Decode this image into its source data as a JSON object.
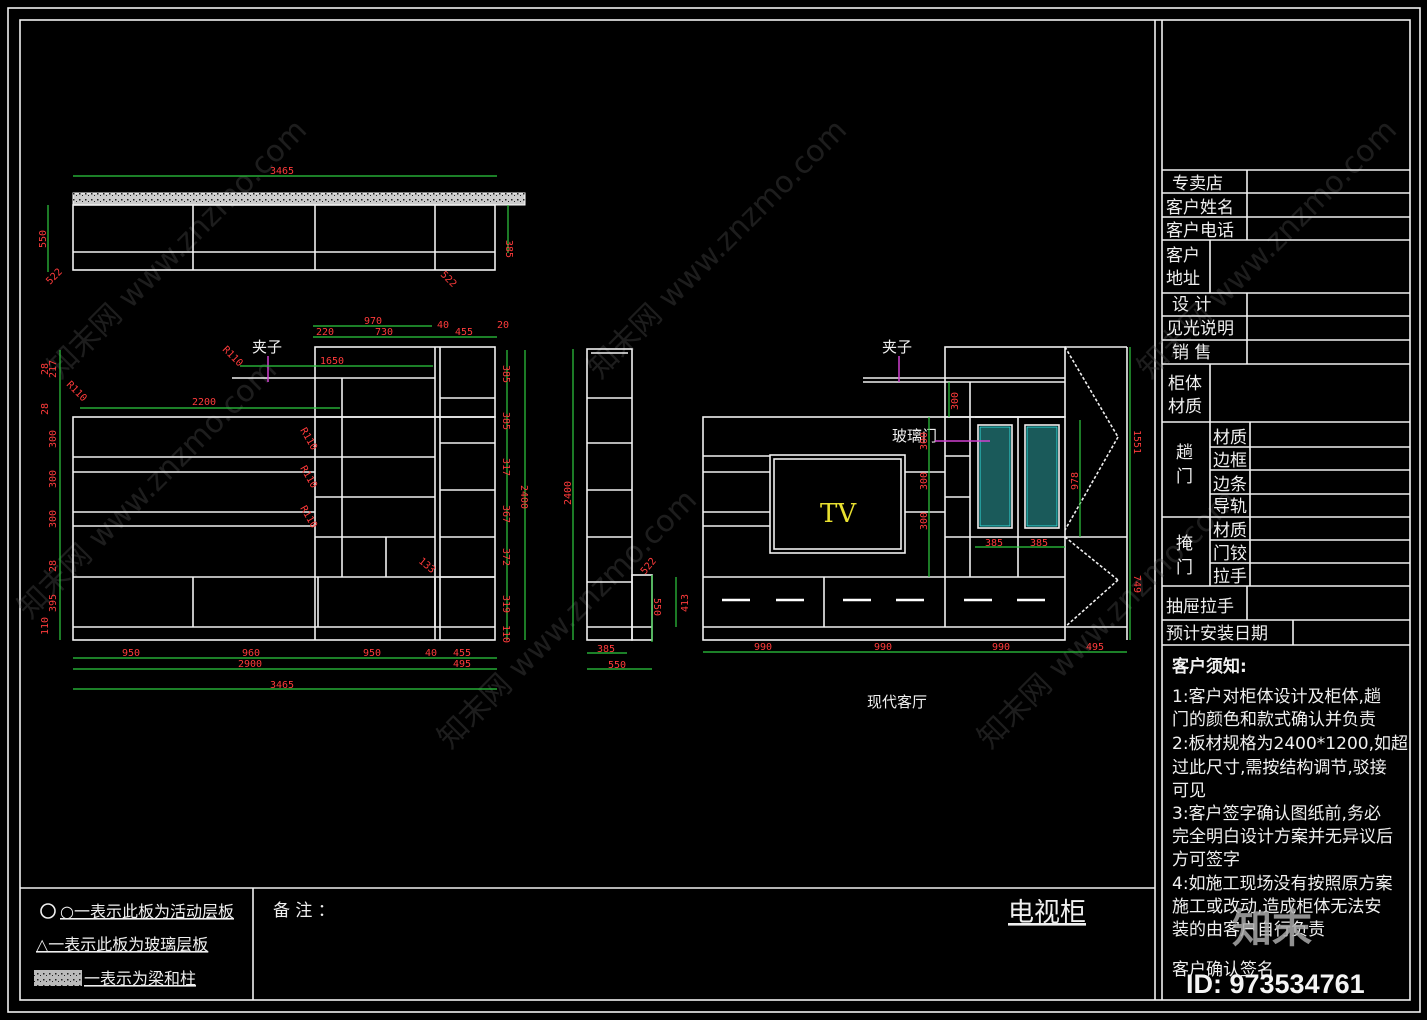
{
  "colors": {
    "background": "#000000",
    "lines": "#f0f0f0",
    "dimension_lines": "#2ecc40",
    "dimension_text": "#ff3b3b",
    "leader": "#d040d0",
    "glass": "#2fd8d8",
    "tv_text": "#e8e030"
  },
  "drawing": {
    "clip_label": "夹子",
    "glass_door_label": "玻璃门",
    "tv_label": "TV",
    "view_caption": "现代客厅",
    "left_dims": {
      "top_total": "3465",
      "top_height": "550",
      "top_right": "385",
      "corner_l": "522",
      "corner_r": "522",
      "d970": "970",
      "d40": "40",
      "d20": "20",
      "d220": "220",
      "d730": "730",
      "d455": "455",
      "d1650": "1650",
      "d2200": "2200",
      "r1": "R110",
      "r2": "R110",
      "r3": "R110",
      "r4": "R110",
      "r5": "R110",
      "b950a": "950",
      "b960": "960",
      "b950b": "950",
      "b40": "40",
      "b455": "455",
      "b2900": "2900",
      "b495": "495",
      "b3465": "3465",
      "v217": "217",
      "v28a": "28",
      "v28b": "28",
      "v300a": "300",
      "v300b": "300",
      "v300c": "300",
      "v28c": "28",
      "v395": "395",
      "v110": "110",
      "r385a": "385",
      "r385b": "385",
      "r317": "317",
      "r367": "367",
      "r372": "372",
      "r319": "319",
      "r110": "110",
      "h2400": "2400",
      "e133": "133"
    },
    "side_dims": {
      "h2400": "2400",
      "d522": "522",
      "d550v": "550",
      "w385": "385",
      "w550": "550"
    },
    "right_dims": {
      "d300top": "300",
      "d300a": "300",
      "d300b": "300",
      "d300c": "300",
      "d978": "978",
      "d1551": "1551",
      "d749": "749",
      "g385a": "385",
      "g385b": "385",
      "d413": "413",
      "w990a": "990",
      "w990b": "990",
      "w990c": "990",
      "w495": "495"
    }
  },
  "legend": [
    {
      "symbol": "circle",
      "text": "○一表示此板为活动层板"
    },
    {
      "symbol": "triangle",
      "text": "△一表示此板为玻璃层板"
    },
    {
      "symbol": "hatch",
      "text": "一表示为梁和柱"
    }
  ],
  "remarks_label": "备  注 ：",
  "drawing_title": "电视柜",
  "title_block": {
    "rows": [
      "专卖店",
      "客户姓名",
      "客户电话",
      "客户",
      "地址",
      "设  计",
      "见光说明",
      "销  售",
      "柜体",
      "材质",
      "趟",
      "门",
      "材质",
      "边框",
      "边条",
      "导轨",
      "掩",
      "门",
      "材质",
      "门铰",
      "拉手",
      "抽屉拉手",
      "预计安装日期"
    ],
    "notice_title": "客户须知:",
    "notice_lines": [
      "1:客户对柜体设计及柜体,趟",
      "门的颜色和款式确认并负责",
      "2:板材规格为2400*1200,如超",
      "过此尺寸,需按结构调节,驳接",
      "可见",
      "3:客户签字确认图纸前,务必",
      "完全明白设计方案并无异议后",
      "方可签字",
      "4:如施工现场没有按照原方案",
      "施工或改动,造成柜体无法安",
      "装的由客户自行负责"
    ],
    "signature_label": "客户确认签名"
  },
  "watermark": {
    "site": "知末网 www.znzmo.com",
    "logo": "知末",
    "id": "ID: 973534761"
  }
}
